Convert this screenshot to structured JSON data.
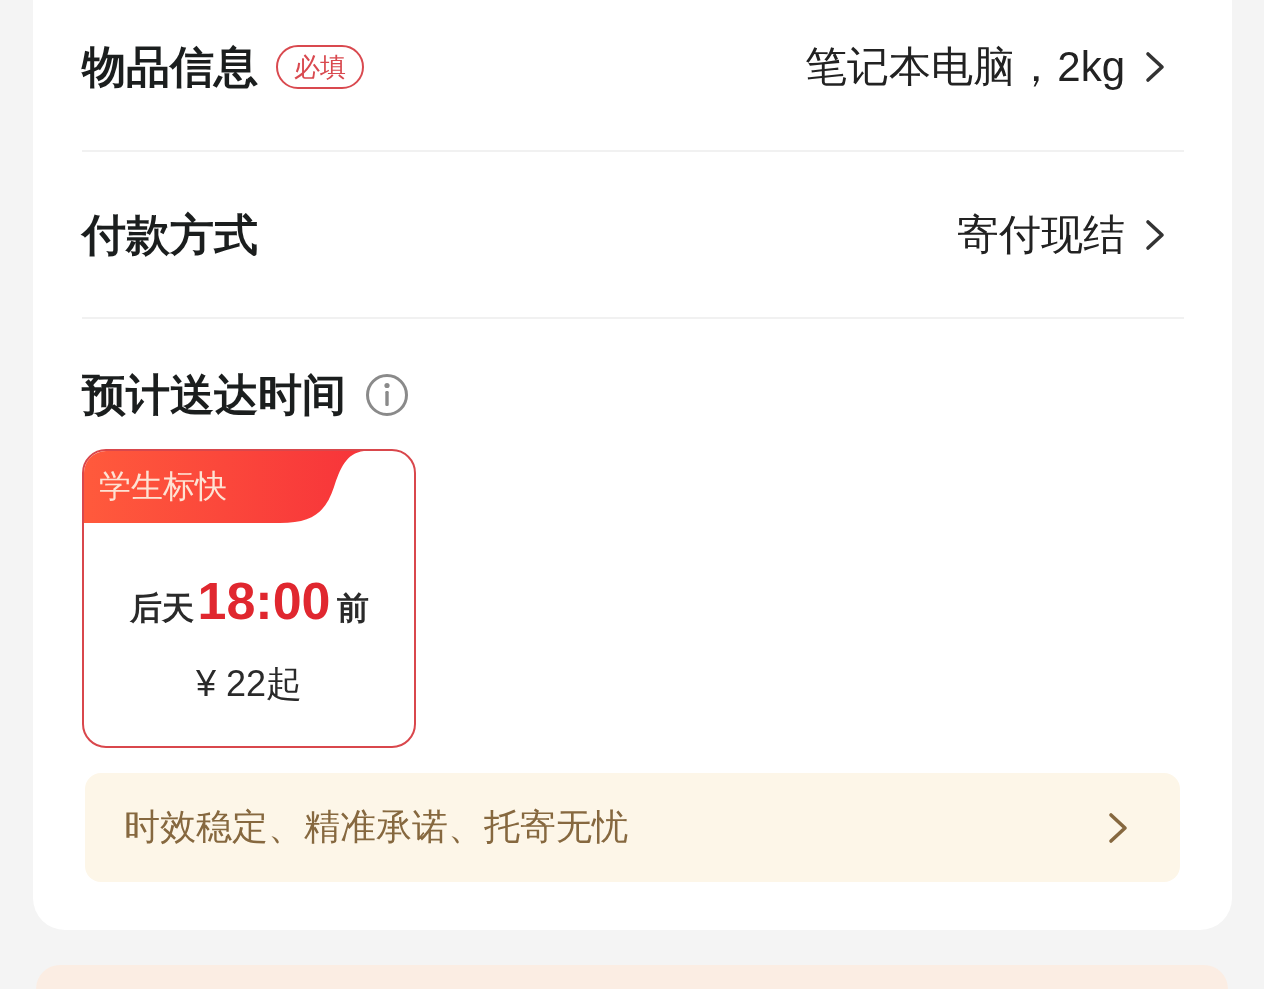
{
  "fields": [
    {
      "label": "物品信息",
      "badge": "必填",
      "value": "笔记本电脑，2kg"
    },
    {
      "label": "付款方式",
      "value": "寄付现结"
    }
  ],
  "delivery": {
    "title": "预计送达时间",
    "options": [
      {
        "tag": "学生标快",
        "prefix": "后天",
        "time": "18:00",
        "suffix": "前",
        "price": "¥ 22起",
        "selected": true
      }
    ]
  },
  "promo": {
    "text": "时效稳定、精准承诺、托寄无忧"
  }
}
